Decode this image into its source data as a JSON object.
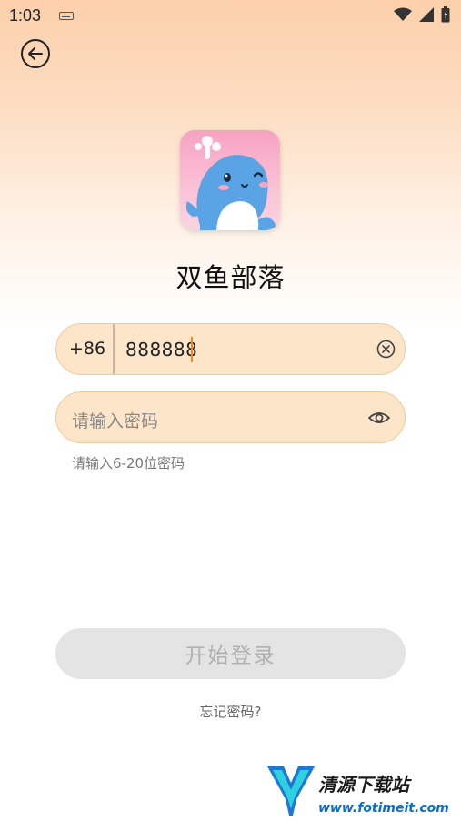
{
  "status_bar": {
    "time": "1:03",
    "icons": [
      "keyboard-icon",
      "wifi-icon",
      "signal-icon",
      "battery-icon"
    ]
  },
  "header": {
    "back_icon": "back-arrow-icon"
  },
  "app": {
    "title": "双鱼部落",
    "icon": "whale-app-icon"
  },
  "phone_field": {
    "country_code": "+86",
    "value": "888888",
    "clear_icon": "clear-icon"
  },
  "password_field": {
    "placeholder": "请输入密码",
    "value": "",
    "toggle_icon": "eye-icon"
  },
  "password_hint": "请输入6-20位密码",
  "login_button": {
    "label": "开始登录",
    "enabled": false
  },
  "forgot_link": "忘记密码?",
  "watermark": {
    "title": "清源下载站",
    "url": "www.fotimeit.com"
  },
  "colors": {
    "field_bg": "#fde5c9",
    "field_border": "#f5c897",
    "caret": "#f08a1c",
    "button_disabled_bg": "#e4e4e4",
    "button_disabled_text": "#b1b1b1"
  }
}
